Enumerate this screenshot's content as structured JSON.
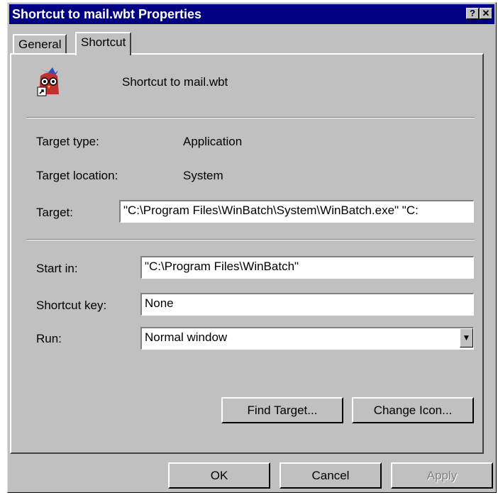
{
  "window": {
    "title": "Shortcut to mail.wbt Properties",
    "help_button": "?",
    "close_button": "✕"
  },
  "tabs": [
    {
      "label": "General"
    },
    {
      "label": "Shortcut"
    }
  ],
  "shortcut": {
    "name": "Shortcut to mail.wbt",
    "target_type_label": "Target type:",
    "target_type_value": "Application",
    "target_location_label": "Target location:",
    "target_location_value": "System",
    "target_label": "Target:",
    "target_value": "\"C:\\Program Files\\WinBatch\\System\\WinBatch.exe\" \"C:",
    "start_in_label": "Start in:",
    "start_in_value": "\"C:\\Program Files\\WinBatch\"",
    "shortcut_key_label": "Shortcut key:",
    "shortcut_key_value": "None",
    "run_label": "Run:",
    "run_value": "Normal window",
    "find_target_label": "Find Target...",
    "change_icon_label": "Change Icon..."
  },
  "footer": {
    "ok_label": "OK",
    "cancel_label": "Cancel",
    "apply_label": "Apply"
  },
  "icons": {
    "shortcut_icon": "winbatch-owl-icon",
    "dropdown": "chevron-down-icon"
  }
}
